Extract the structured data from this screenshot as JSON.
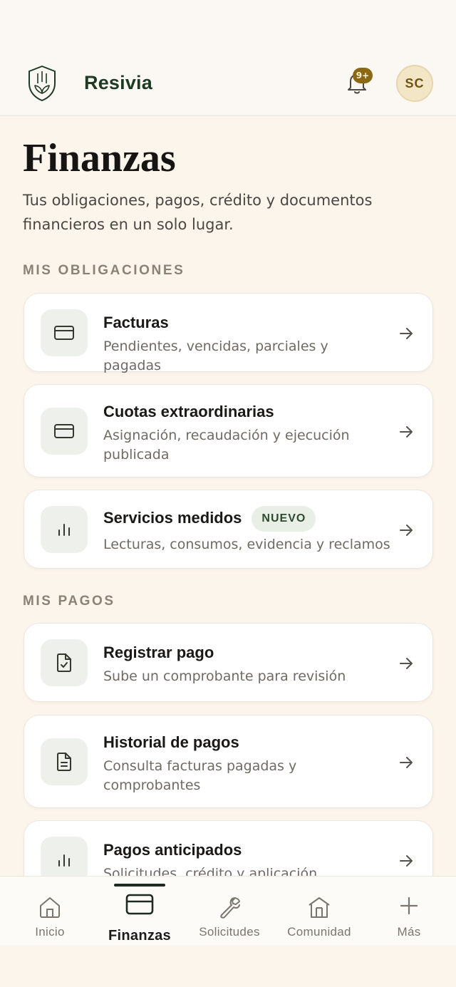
{
  "app": {
    "name": "Resivia",
    "notifications_badge": "9+",
    "avatar_initials": "SC",
    "colors": {
      "brand": "#1f3a24",
      "accent": "#8b6914",
      "background": "#fcf5ec"
    }
  },
  "page": {
    "title": "Finanzas",
    "subtitle": "Tus obligaciones, pagos, crédito y documentos financieros en un solo lugar."
  },
  "sections": {
    "obligaciones": {
      "label": "MIS OBLIGACIONES",
      "items": [
        {
          "title": "Facturas",
          "description": "Pendientes, vencidas, parciales y pagadas",
          "icon": "credit-card-icon"
        },
        {
          "title": "Cuotas extraordinarias",
          "description": "Asignación, recaudación y ejecución publicada",
          "icon": "credit-card-icon"
        },
        {
          "title": "Servicios medidos",
          "badge": "NUEVO",
          "description": "Lecturas, consumos, evidencia y reclamos",
          "icon": "bar-chart-icon"
        }
      ]
    },
    "pagos": {
      "label": "MIS PAGOS",
      "items": [
        {
          "title": "Registrar pago",
          "description": "Sube un comprobante para revisión",
          "icon": "file-check-icon"
        },
        {
          "title": "Historial de pagos",
          "description": "Consulta facturas pagadas y comprobantes",
          "icon": "file-text-icon"
        },
        {
          "title": "Pagos anticipados",
          "description": "Solicitudes, crédito y aplicación",
          "icon": "bar-chart-icon"
        }
      ]
    }
  },
  "tabbar": {
    "tabs": [
      {
        "label": "Inicio",
        "icon": "home-icon",
        "active": false
      },
      {
        "label": "Finanzas",
        "icon": "credit-card-icon",
        "active": true
      },
      {
        "label": "Solicitudes",
        "icon": "wrench-icon",
        "active": false
      },
      {
        "label": "Comunidad",
        "icon": "building-icon",
        "active": false
      },
      {
        "label": "Más",
        "icon": "plus-icon",
        "active": false
      }
    ]
  }
}
